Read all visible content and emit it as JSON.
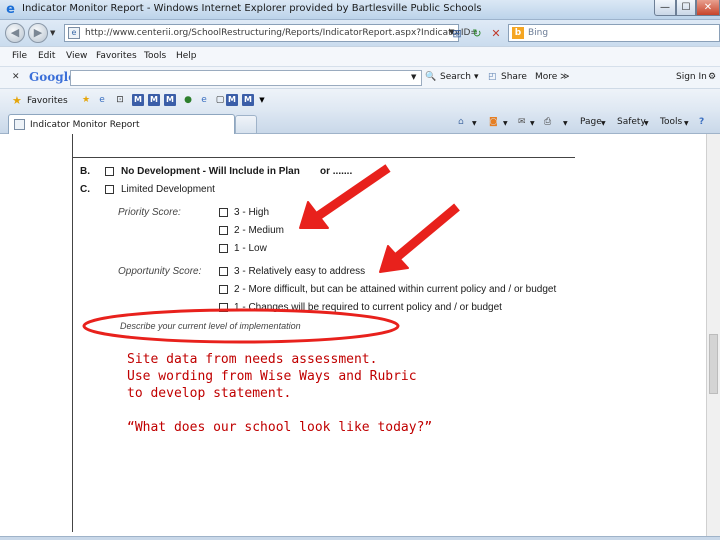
{
  "window": {
    "title": "Indicator Monitor Report - Windows Internet Explorer provided by Bartlesville Public Schools",
    "min_label": "—",
    "max_label": "☐",
    "close_label": "✕"
  },
  "address_bar": {
    "url": "http://www.centerii.org/SchoolRestructuring/Reports/IndicatorReport.aspx?IndicatorID=",
    "search_placeholder": "Bing"
  },
  "menu": {
    "items": [
      "File",
      "Edit",
      "View",
      "Favorites",
      "Tools",
      "Help"
    ]
  },
  "google_toolbar": {
    "logo": "Google",
    "search_label": "Search",
    "share_label": "Share",
    "more_label": "More ≫",
    "signin_label": "Sign In"
  },
  "favorites_bar": {
    "label": "Favorites"
  },
  "tab": {
    "active_label": "Indicator Monitor Report"
  },
  "command_bar": {
    "page_label": "Page",
    "safety_label": "Safety",
    "tools_label": "Tools",
    "help_label": "?"
  },
  "form": {
    "option_b_letter": "B.",
    "option_b_label": "No Development - Will Include in Plan",
    "option_b_or": "or .......",
    "option_c_letter": "C.",
    "option_c_label": "Limited Development",
    "priority_label": "Priority Score:",
    "priority_options": [
      "3 - High",
      "2 - Medium",
      "1 - Low"
    ],
    "opportunity_label": "Opportunity Score:",
    "opportunity_options": [
      "3 - Relatively easy to address",
      "2 - More difficult, but can be attained within current policy and / or budget",
      "1 - Changes will be required to current policy and / or budget"
    ],
    "describe_label": "Describe your current level of implementation"
  },
  "overlay": {
    "line1": "Site data from needs assessment.",
    "line2": "Use wording from Wise Ways and Rubric",
    "line3": "to develop statement.",
    "quote": "“What does our school look like today?”"
  },
  "colors": {
    "arrow": "#e8211c",
    "ellipse": "#e8211c",
    "overlay_text": "#c00000"
  }
}
